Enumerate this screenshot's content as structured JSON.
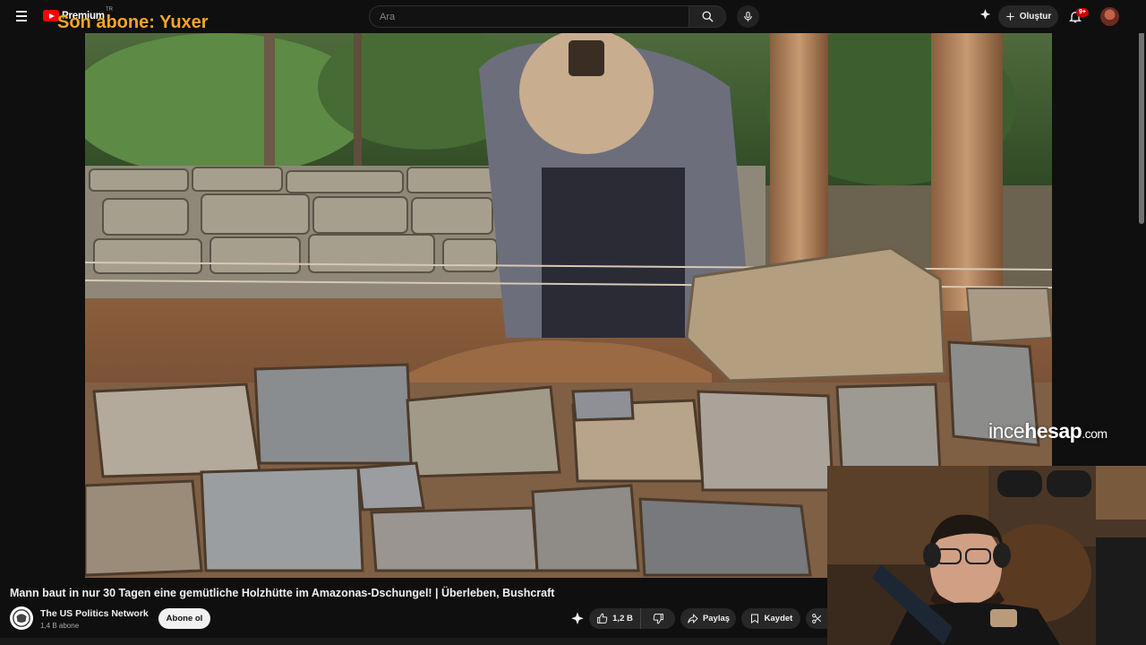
{
  "header": {
    "logo_text": "Premium",
    "logo_tr": "TR",
    "overlay_subscriber_text": "Son abone: Yuxer",
    "search_placeholder": "Ara",
    "create_label": "Oluştur",
    "notification_count": "9+"
  },
  "video": {
    "watermark_a": "ince",
    "watermark_b": "hesap",
    "watermark_c": ".com",
    "title": "Mann baut in nur 30 Tagen eine gemütliche Holzhütte im Amazonas-Dschungel! | Überleben, Bushcraft"
  },
  "channel": {
    "name": "The US Politics Network",
    "subscribers": "1,4 B abone",
    "subscribe_label": "Abone ol"
  },
  "actions": {
    "likes": "1,2 B",
    "share_label": "Paylaş",
    "save_label": "Kaydet"
  },
  "colors": {
    "background": "#0f0f0f",
    "brand_red": "#ff0000",
    "overlay_orange": "#f5a623",
    "button_bg": "#272727"
  }
}
